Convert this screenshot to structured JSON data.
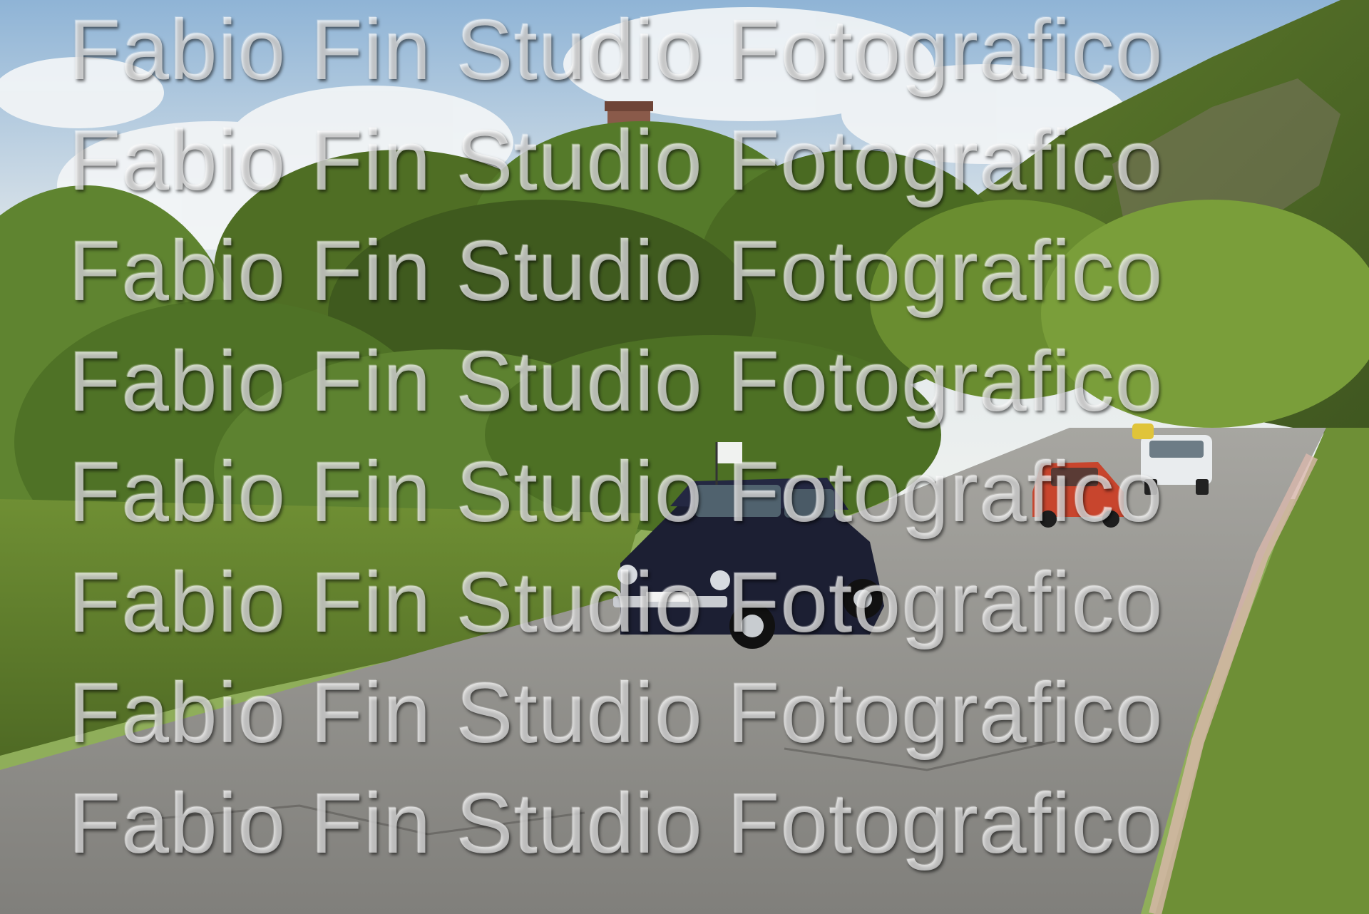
{
  "photo": {
    "description_icon": "photo-scene",
    "colors": {
      "sky": "#dfe8ee",
      "sky_blue": "#9fc0dc",
      "foliage": "#6f8f32",
      "foliage_dark": "#3f5a1e",
      "road": "#8b8a86",
      "dark_car": "#1c1f33",
      "red_car": "#c8452d",
      "white_car": "#e9ecee",
      "tower": "#8a5a4a"
    },
    "objects": [
      "brick-tower",
      "green-hillside",
      "roadside-bushes",
      "asphalt-road",
      "dark-fiat-500",
      "red-fiat-500",
      "white-pickup-truck",
      "yellow-car"
    ]
  },
  "watermark": {
    "lines": [
      "Fabio Fin Studio Fotografico",
      "Fabio Fin Studio Fotografico",
      "Fabio Fin Studio Fotografico",
      "Fabio Fin Studio Fotografico",
      "Fabio Fin Studio Fotografico",
      "Fabio Fin Studio Fotografico",
      "Fabio Fin Studio Fotografico",
      "Fabio Fin Studio Fotografico"
    ]
  }
}
